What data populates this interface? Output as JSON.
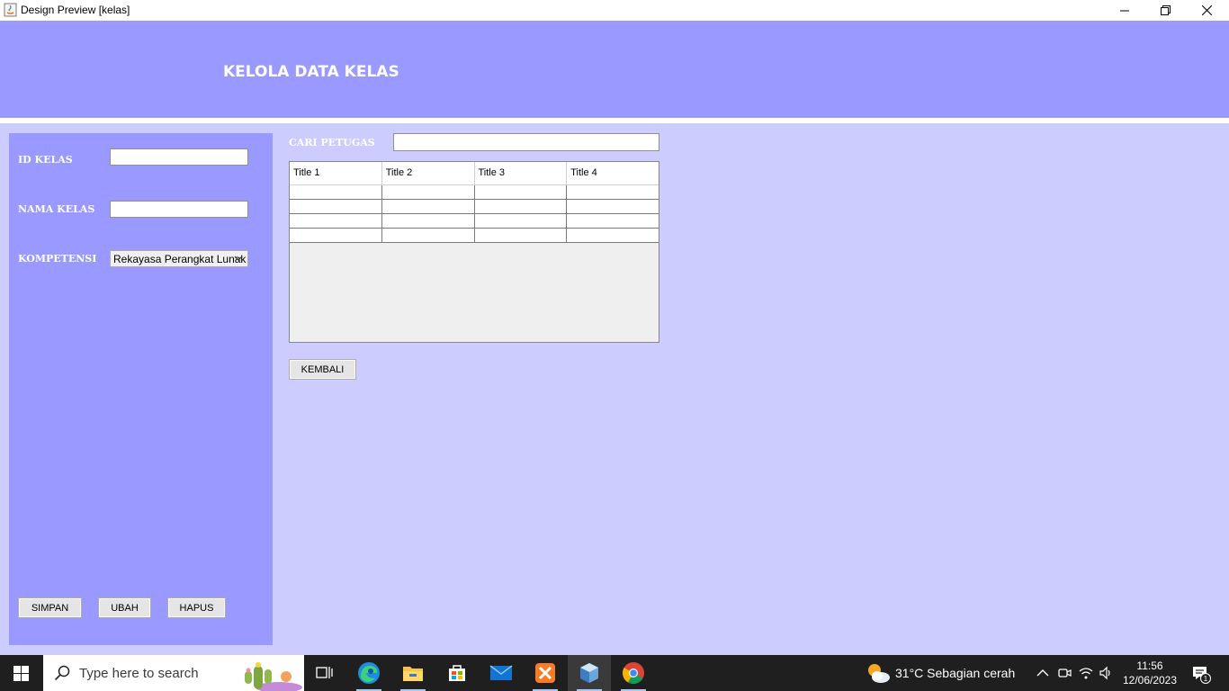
{
  "window": {
    "title": "Design Preview [kelas]"
  },
  "header": {
    "title": "KELOLA DATA KELAS"
  },
  "form": {
    "id_label": "ID KELAS",
    "id_value": "",
    "name_label": "NAMA KELAS",
    "name_value": "",
    "kompetensi_label": "KOMPETENSI",
    "kompetensi_selected": "Rekayasa Perangkat Lunak",
    "buttons": {
      "simpan": "SIMPAN",
      "ubah": "UBAH",
      "hapus": "HAPUS"
    }
  },
  "search": {
    "label": "CARI PETUGAS",
    "value": ""
  },
  "table": {
    "columns": [
      "Title 1",
      "Title 2",
      "Title 3",
      "Title 4"
    ],
    "rows": [
      [
        "",
        "",
        "",
        ""
      ],
      [
        "",
        "",
        "",
        ""
      ],
      [
        "",
        "",
        "",
        ""
      ],
      [
        "",
        "",
        "",
        ""
      ]
    ]
  },
  "back_button": "KEMBALI",
  "taskbar": {
    "search_placeholder": "Type here to search",
    "weather": "31°C  Sebagian cerah",
    "time": "11:56",
    "date": "12/06/2023",
    "notification_count": "1"
  },
  "colors": {
    "header_bg": "#9999ff",
    "content_bg": "#ccccfe",
    "panel_bg": "#9999ff"
  }
}
